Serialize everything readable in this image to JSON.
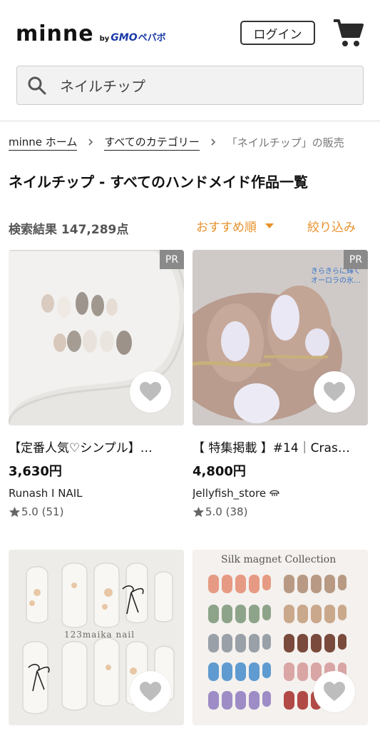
{
  "header": {
    "logo_main": "minne",
    "logo_by": "by",
    "logo_gmo": "GMO",
    "logo_pepabo": "ペパボ",
    "login_label": "ログイン",
    "cart_icon": "cart-icon"
  },
  "search": {
    "value": "ネイルチップ",
    "icon": "search-icon"
  },
  "breadcrumb": {
    "home": "minne ホーム",
    "categories": "すべてのカテゴリー",
    "current": "「ネイルチップ」の販売"
  },
  "page_title": "ネイルチップ - すべてのハンドメイド作品一覧",
  "results": {
    "count_label": "検索結果 147,289点",
    "sort_label": "おすすめ順",
    "filter_label": "絞り込み"
  },
  "products": [
    {
      "badge": "PR",
      "title": "【定番人気♡シンプル】…",
      "price": "3,630円",
      "shop": "Runash I NAIL",
      "rating": "5.0",
      "reviews": "(51)"
    },
    {
      "badge": "PR",
      "title": "【 特集掲載 】#14｜Cras…",
      "price": "4,800円",
      "shop": "Jellyfish_store",
      "rating": "5.0",
      "reviews": "(38)",
      "overlay_line1": "きらきらに輝く",
      "overlay_line2": "オーロラの氷…"
    },
    {
      "overlay": "123maika nail"
    },
    {
      "overlay": "Silk magnet Collection"
    }
  ],
  "colors": {
    "accent": "#e8922e",
    "text": "#222222",
    "pr_badge": "#8a8a8a"
  }
}
